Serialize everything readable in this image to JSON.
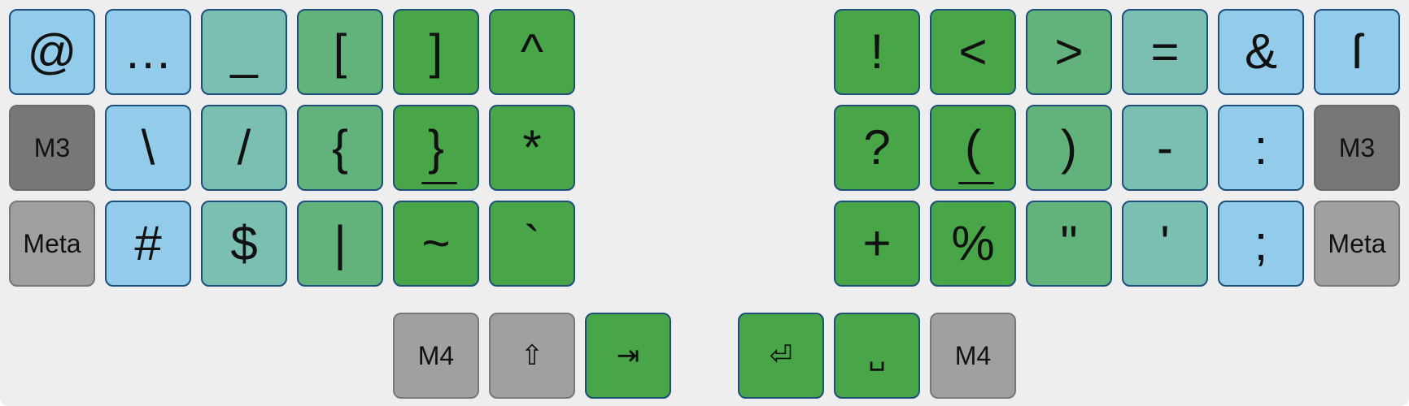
{
  "colors": {
    "blue": "#93cbea",
    "teal": "#7bbfb3",
    "mint": "#62b27c",
    "green": "#48a548",
    "gray": "#a0a0a0",
    "dark": "#777777"
  },
  "keys": [
    {
      "label": "@",
      "color": "blue"
    },
    {
      "label": "…",
      "color": "blue"
    },
    {
      "label": "_",
      "color": "teal"
    },
    {
      "label": "[",
      "color": "mint"
    },
    {
      "label": "]",
      "color": "green"
    },
    {
      "label": "^",
      "color": "green"
    },
    {
      "label": "!",
      "color": "green"
    },
    {
      "label": "<",
      "color": "green"
    },
    {
      "label": ">",
      "color": "mint"
    },
    {
      "label": "=",
      "color": "teal"
    },
    {
      "label": "&",
      "color": "blue"
    },
    {
      "label": "ſ",
      "color": "blue"
    },
    {
      "label": "M3",
      "color": "dark"
    },
    {
      "label": "\\",
      "color": "blue"
    },
    {
      "label": "/",
      "color": "teal"
    },
    {
      "label": "{",
      "color": "mint"
    },
    {
      "label": "}",
      "color": "green",
      "underline": true
    },
    {
      "label": "*",
      "color": "green"
    },
    {
      "label": "?",
      "color": "green"
    },
    {
      "label": "(",
      "color": "green",
      "underline": true
    },
    {
      "label": ")",
      "color": "mint"
    },
    {
      "label": "-",
      "color": "teal"
    },
    {
      "label": ":",
      "color": "blue"
    },
    {
      "label": "M3",
      "color": "dark"
    },
    {
      "label": "Meta",
      "color": "gray"
    },
    {
      "label": "#",
      "color": "blue"
    },
    {
      "label": "$",
      "color": "teal"
    },
    {
      "label": "|",
      "color": "mint"
    },
    {
      "label": "~",
      "color": "green"
    },
    {
      "label": "`",
      "color": "green"
    },
    {
      "label": "+",
      "color": "green"
    },
    {
      "label": "%",
      "color": "green"
    },
    {
      "label": "\"",
      "color": "mint"
    },
    {
      "label": "'",
      "color": "teal"
    },
    {
      "label": ";",
      "color": "blue"
    },
    {
      "label": "Meta",
      "color": "gray"
    },
    {
      "label": "M4",
      "color": "gray"
    },
    {
      "label": "⇧",
      "color": "gray"
    },
    {
      "label": "⇥",
      "color": "green"
    },
    {
      "label": "⏎",
      "color": "green"
    },
    {
      "label": "␣",
      "color": "green"
    },
    {
      "label": "M4",
      "color": "gray"
    }
  ]
}
